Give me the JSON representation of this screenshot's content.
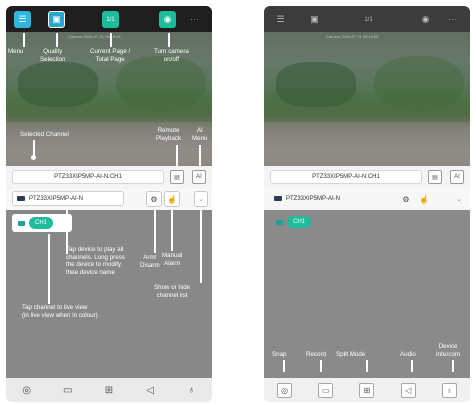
{
  "left": {
    "top_bar": {
      "page_indicator": "1/1",
      "more_icon": "more-icon"
    },
    "video": {
      "osd_text": "Camera  2024-07-31 09:15:28"
    },
    "selected_channel": "PTZ33XIP5MP-AI-N:CH1",
    "device_name": "PTZ33XIP5MP-AI-N",
    "channel_pill": "CH1",
    "annotations": {
      "menu": "Menu",
      "quality": "Quality\nSelection",
      "current_page": "Current Page /\nTotal Page",
      "turn_camera": "Turn camera\non/off",
      "selected_channel": "Selected Channel",
      "remote_playback": "Remote\nPlayback",
      "ai_menu": "AI\nMenu",
      "arm_disarm": "Arm/\nDisarm",
      "manual_alarm": "Manual\nAlarm",
      "tap_device": "Tap device to play all\nchannels. Long press\nthe device to modify\nthee device name",
      "show_hide": "Show or hide\nchannel list",
      "tap_channel": "Tap channel to live view\n(in live view when in colour)"
    },
    "ai_label": "AI"
  },
  "right": {
    "top_bar": {
      "page_indicator": "1/1"
    },
    "video": {
      "osd_text": "Camera  2024-07-31 09:15:28"
    },
    "selected_channel": "PTZ33XIP5MP-AI-N:CH1",
    "device_name": "PTZ33XIP5MP-AI-N",
    "channel_pill": "CH1",
    "ai_label": "AI",
    "annotations": {
      "snap": "Snap",
      "record": "Record",
      "split_mode": "Split Mode",
      "audio": "Audio",
      "device_intercom": "Device\nIntercom"
    }
  },
  "colors": {
    "accent": "#1fbc9c",
    "top_bar": "#1e1e1e",
    "overlay": "#888888"
  }
}
